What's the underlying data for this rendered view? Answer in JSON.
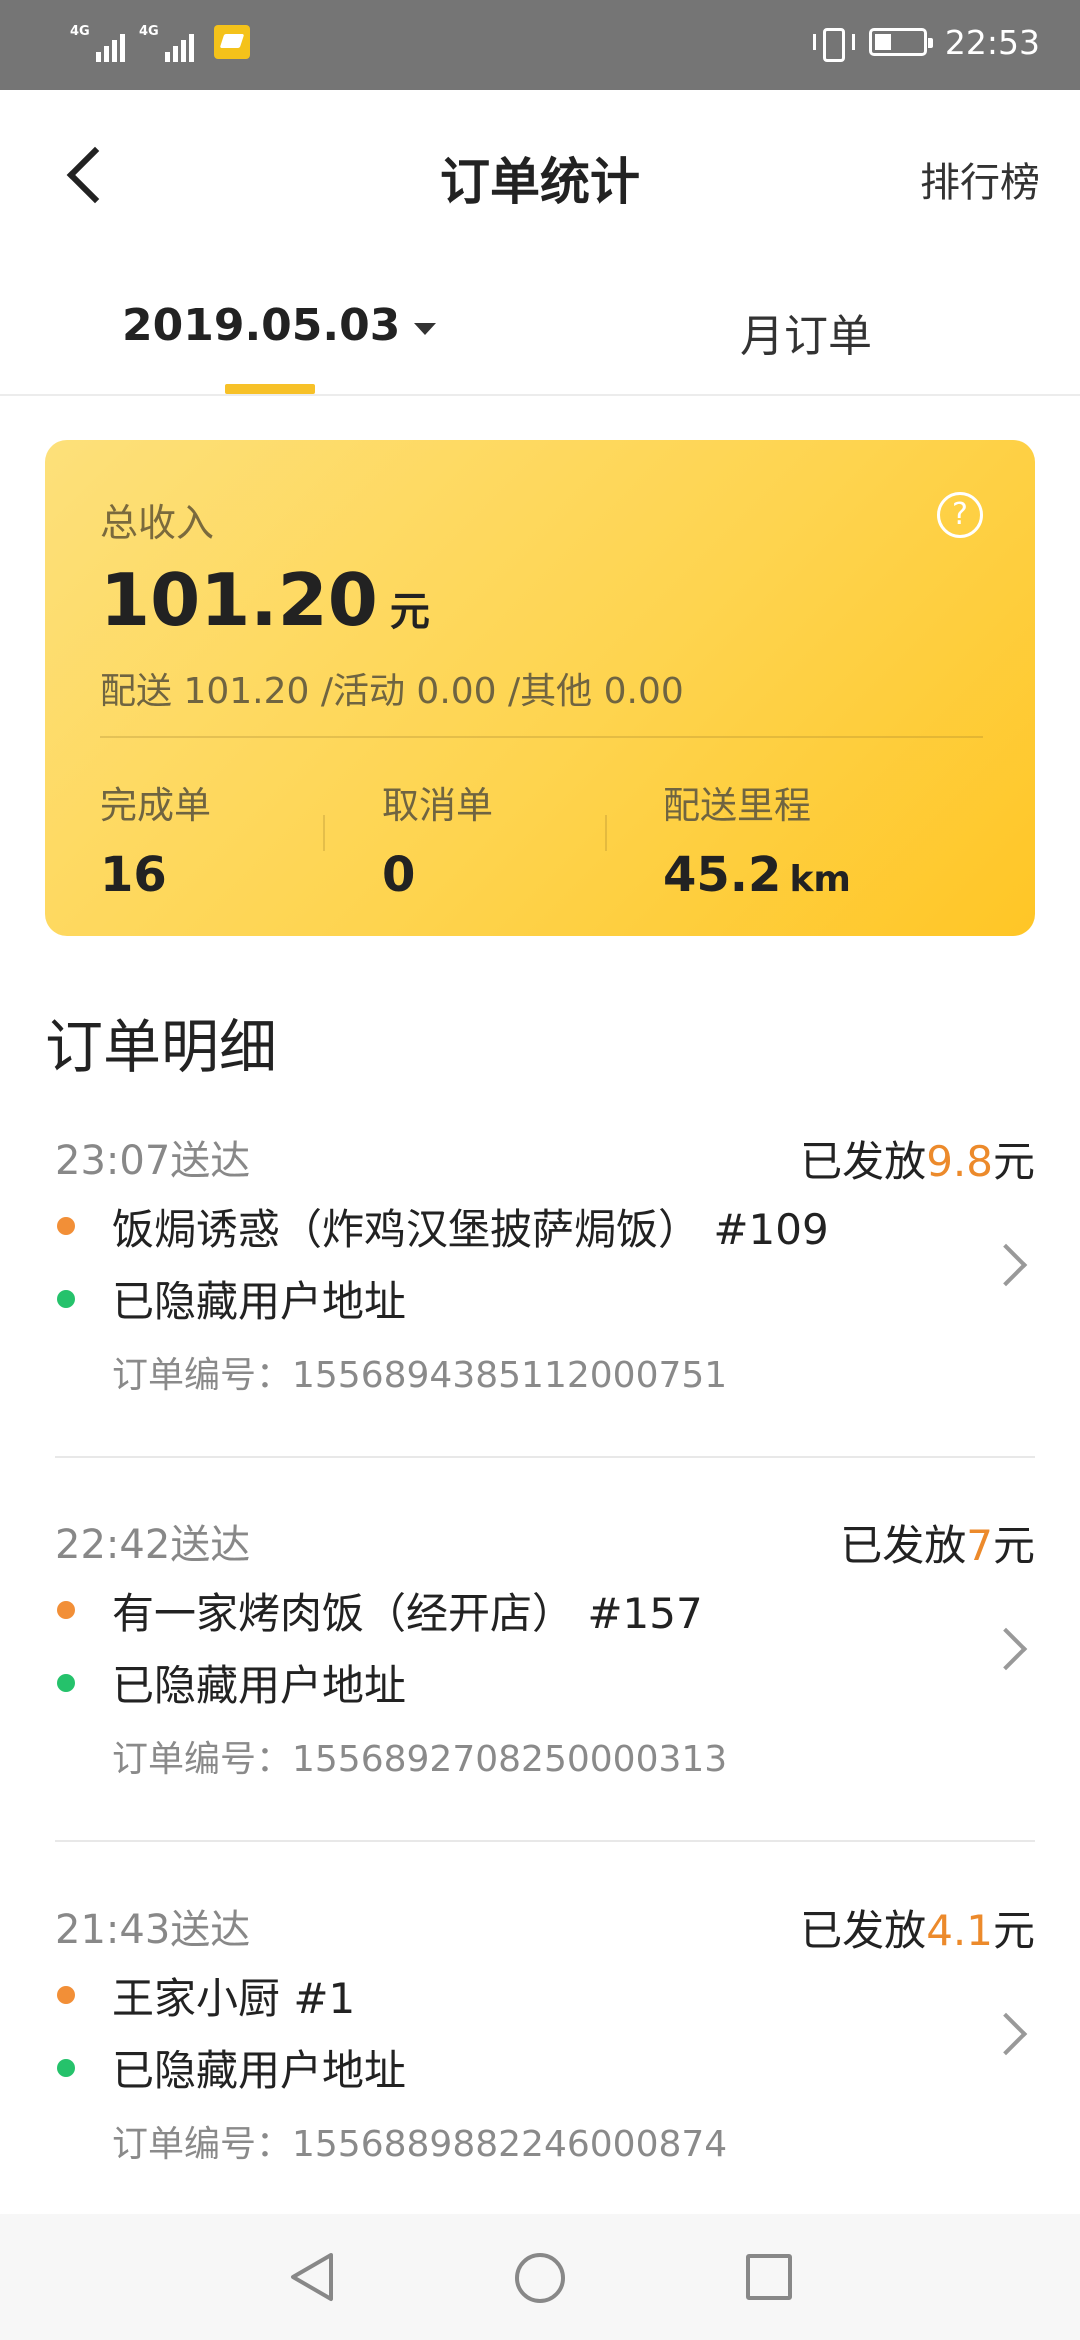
{
  "status_bar": {
    "network_left": "4G",
    "network_right": "4G",
    "time": "22:53"
  },
  "header": {
    "title": "订单统计",
    "ranking_label": "排行榜"
  },
  "tabs": {
    "date_label": "2019.05.03",
    "month_label": "月订单"
  },
  "summary": {
    "income_label": "总收入",
    "income_value": "101.20",
    "income_unit": "元",
    "breakdown": "配送 101.20  /活动 0.00  /其他 0.00",
    "stats": [
      {
        "label": "完成单",
        "value": "16",
        "unit": ""
      },
      {
        "label": "取消单",
        "value": "0",
        "unit": ""
      },
      {
        "label": "配送里程",
        "value": "45.2",
        "unit": "km"
      }
    ]
  },
  "orders_section_title": "订单明细",
  "orders": [
    {
      "time": "23:07送达",
      "pay_prefix": "已发放",
      "pay_amount": "9.8",
      "pay_suffix": "元",
      "shop": "饭焗诱惑（炸鸡汉堡披萨焗饭） #109",
      "address": "已隐藏用户地址",
      "order_no": "订单编号：1556894385112000751"
    },
    {
      "time": "22:42送达",
      "pay_prefix": "已发放",
      "pay_amount": "7",
      "pay_suffix": "元",
      "shop": "有一家烤肉饭（经开店） #157",
      "address": "已隐藏用户地址",
      "order_no": "订单编号：1556892708250000313"
    },
    {
      "time": "21:43送达",
      "pay_prefix": "已发放",
      "pay_amount": "4.1",
      "pay_suffix": "元",
      "shop": "王家小厨 #1",
      "address": "已隐藏用户地址",
      "order_no": "订单编号：1556889882246000874"
    }
  ],
  "colors": {
    "accent_yellow": "#f7c128",
    "money_orange": "#ec8a2b",
    "shop_dot": "#f28f37",
    "address_dot": "#25c26b"
  },
  "icons": [
    "signal-icon",
    "app-notification-icon",
    "vibrate-icon",
    "battery-icon",
    "back-arrow-icon",
    "caret-down-icon",
    "help-icon",
    "chevron-right-icon",
    "nav-back-icon",
    "nav-home-icon",
    "nav-recent-icon"
  ]
}
